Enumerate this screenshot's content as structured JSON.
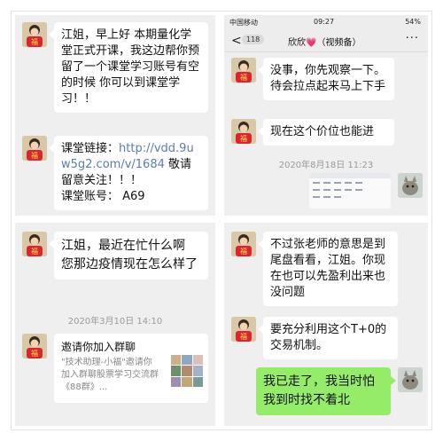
{
  "panels": {
    "tl": {
      "msg1": "江姐，早上好 本期量化学堂正式开课，我这边帮你预留了一个课堂学习账号有空的时候 你可以到课堂学习！！",
      "msg2_prefix": "课堂链接：",
      "msg2_link": "http://vdd.9uw5g2.com/v/1684",
      "msg2_suffix": " 敬请留意关注！！！",
      "msg2_account": "课堂账号： A69"
    },
    "tr": {
      "status_carrier": "中国移动",
      "status_time": "09:27",
      "status_battery": "54%",
      "nav_back": "<",
      "nav_count": "118",
      "nav_title": "欣欣💗（视频备）",
      "nav_more": "···",
      "msg1": "没事，你先观察一下。待会拉点起来马上下手",
      "msg2": "现在这个价位也能进",
      "timestamp": "2020年8月18日 11:23"
    },
    "bl": {
      "msg1": "江姐，最近在忙什么啊 您那边疫情现在怎么样了",
      "timestamp": "2020年3月10日 14:10",
      "card_title": "邀请你加入群聊",
      "card_desc": "\"技术助理-小福\"邀请你加入群聊股票学习交流群《88群》..."
    },
    "br": {
      "msg1": "不过张老师的意思是到尾盘看看，江姐。你现在也可以先盈利出来也没问题",
      "msg2": "要充分利用这个T+0的交易机制。",
      "msg3": "我已走了，我当时怕我到时找不着北"
    }
  },
  "colors": {
    "panel_bg": "#efefef",
    "bubble_white": "#ffffff",
    "bubble_green": "#95ec69",
    "link": "#5b7cb1",
    "timestamp": "#9a9a9a"
  },
  "icons": [
    "avatar-fu-icon",
    "avatar-cat-icon",
    "chevron-left-icon",
    "more-dots-icon",
    "group-thumbnail-icon"
  ]
}
